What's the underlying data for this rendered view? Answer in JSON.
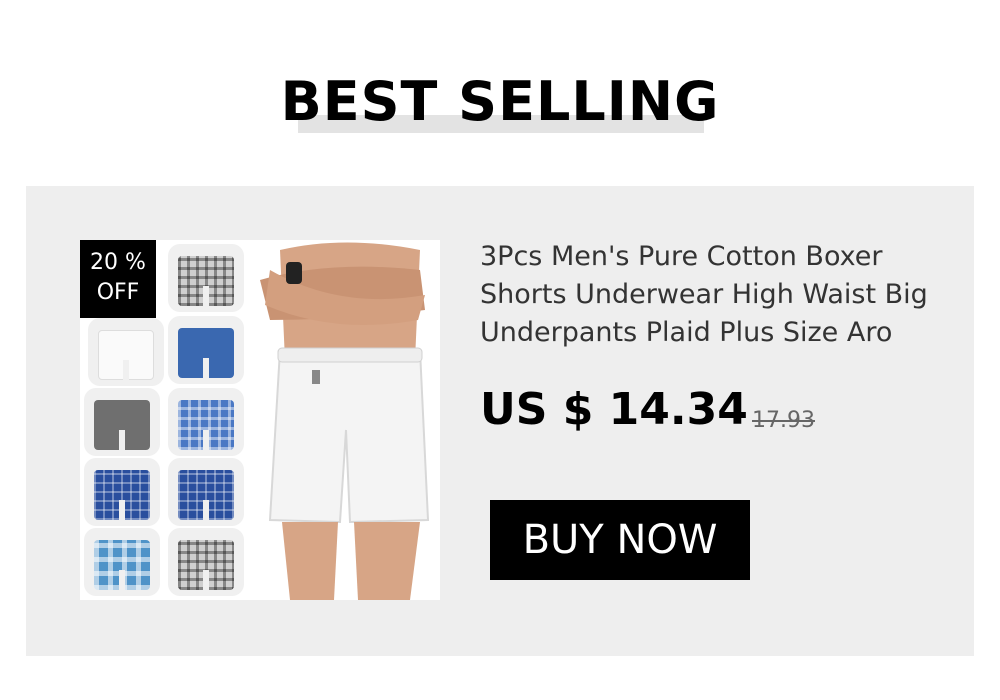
{
  "section": {
    "heading": "BEST SELLING"
  },
  "product": {
    "image_icon": "product-photo-icon",
    "discount_percent": "20 %",
    "discount_label": "OFF",
    "title": "3Pcs Men's Pure Cotton Boxer Shorts Underwear High Waist Big Underpants Plaid Plus Size Aro",
    "price": "US $ 14.34",
    "old_price": "17.93",
    "buy_button_label": "BUY NOW"
  },
  "colors": {
    "background": "#ffffff",
    "card_background": "#eeeeee",
    "button_background": "#000000",
    "button_text": "#ffffff",
    "heading_underline": "#e3e3e3"
  }
}
